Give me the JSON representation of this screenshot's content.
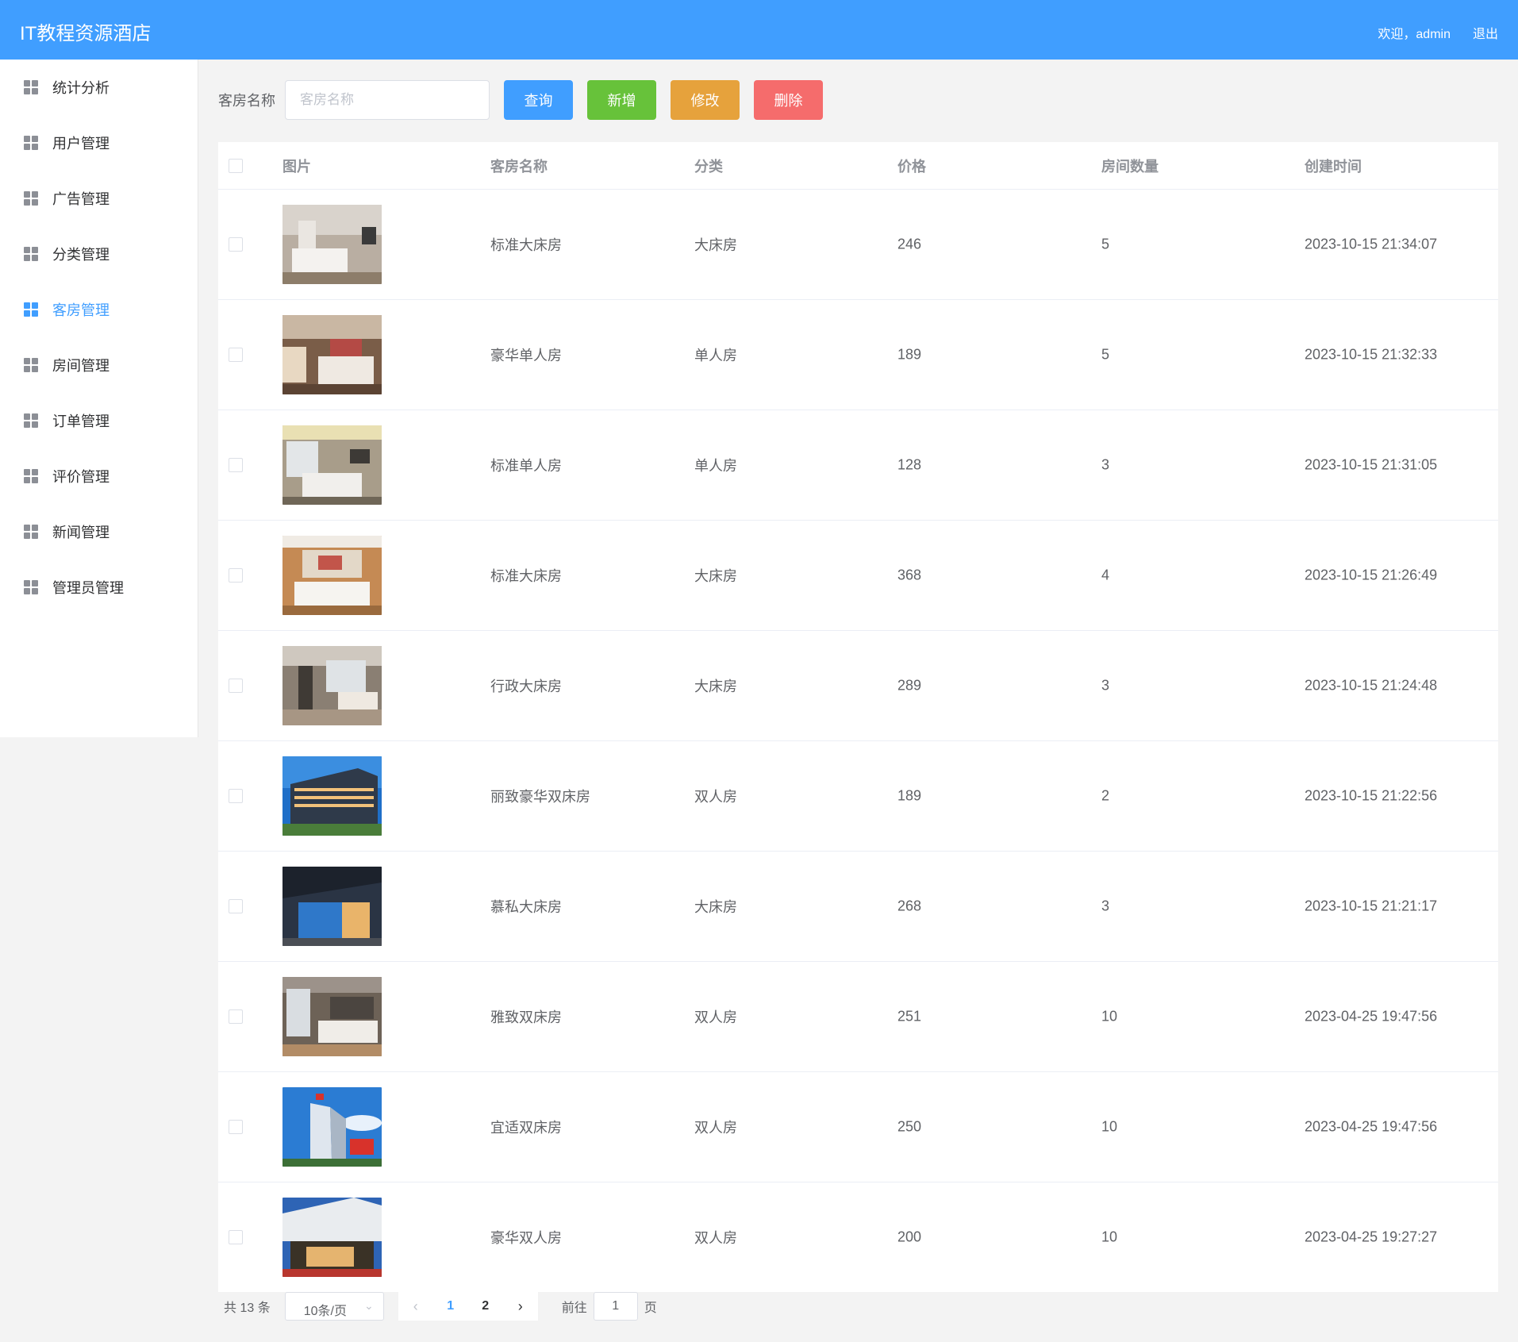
{
  "header": {
    "brand": "IT教程资源酒店",
    "welcome": "欢迎，admin",
    "logout": "退出"
  },
  "sidebar": {
    "items": [
      {
        "label": "统计分析",
        "active": false
      },
      {
        "label": "用户管理",
        "active": false
      },
      {
        "label": "广告管理",
        "active": false
      },
      {
        "label": "分类管理",
        "active": false
      },
      {
        "label": "客房管理",
        "active": true
      },
      {
        "label": "房间管理",
        "active": false
      },
      {
        "label": "订单管理",
        "active": false
      },
      {
        "label": "评价管理",
        "active": false
      },
      {
        "label": "新闻管理",
        "active": false
      },
      {
        "label": "管理员管理",
        "active": false
      }
    ]
  },
  "toolbar": {
    "label": "客房名称",
    "placeholder": "客房名称",
    "value": "",
    "query": "查询",
    "add": "新增",
    "edit": "修改",
    "delete": "删除"
  },
  "table": {
    "columns": [
      "图片",
      "客房名称",
      "分类",
      "价格",
      "房间数量",
      "创建时间"
    ],
    "rows": [
      {
        "name": "标准大床房",
        "category": "大床房",
        "price": "246",
        "count": "5",
        "created": "2023-10-15 21:34:07",
        "image": "hotel-room-photo"
      },
      {
        "name": "豪华单人房",
        "category": "单人房",
        "price": "189",
        "count": "5",
        "created": "2023-10-15 21:32:33",
        "image": "hotel-room-photo"
      },
      {
        "name": "标准单人房",
        "category": "单人房",
        "price": "128",
        "count": "3",
        "created": "2023-10-15 21:31:05",
        "image": "hotel-room-photo"
      },
      {
        "name": "标准大床房",
        "category": "大床房",
        "price": "368",
        "count": "4",
        "created": "2023-10-15 21:26:49",
        "image": "hotel-room-photo"
      },
      {
        "name": "行政大床房",
        "category": "大床房",
        "price": "289",
        "count": "3",
        "created": "2023-10-15 21:24:48",
        "image": "hotel-room-photo"
      },
      {
        "name": "丽致豪华双床房",
        "category": "双人房",
        "price": "189",
        "count": "2",
        "created": "2023-10-15 21:22:56",
        "image": "hotel-building-photo"
      },
      {
        "name": "慕私大床房",
        "category": "大床房",
        "price": "268",
        "count": "3",
        "created": "2023-10-15 21:21:17",
        "image": "hotel-entrance-photo"
      },
      {
        "name": "雅致双床房",
        "category": "双人房",
        "price": "251",
        "count": "10",
        "created": "2023-04-25 19:47:56",
        "image": "hotel-room-photo"
      },
      {
        "name": "宜适双床房",
        "category": "双人房",
        "price": "250",
        "count": "10",
        "created": "2023-04-25 19:47:56",
        "image": "hotel-building-photo"
      },
      {
        "name": "豪华双人房",
        "category": "双人房",
        "price": "200",
        "count": "10",
        "created": "2023-04-25 19:27:27",
        "image": "hotel-entrance-photo"
      }
    ]
  },
  "pagination": {
    "total": "共 13 条",
    "page_size": "10条/页",
    "pages": [
      "1",
      "2"
    ],
    "current": "1",
    "goto_prefix": "前往",
    "goto_value": "1",
    "goto_suffix": "页"
  },
  "colors": {
    "primary": "#409eff",
    "success": "#67c23a",
    "warning": "#e6a23c",
    "danger": "#f56c6c"
  }
}
